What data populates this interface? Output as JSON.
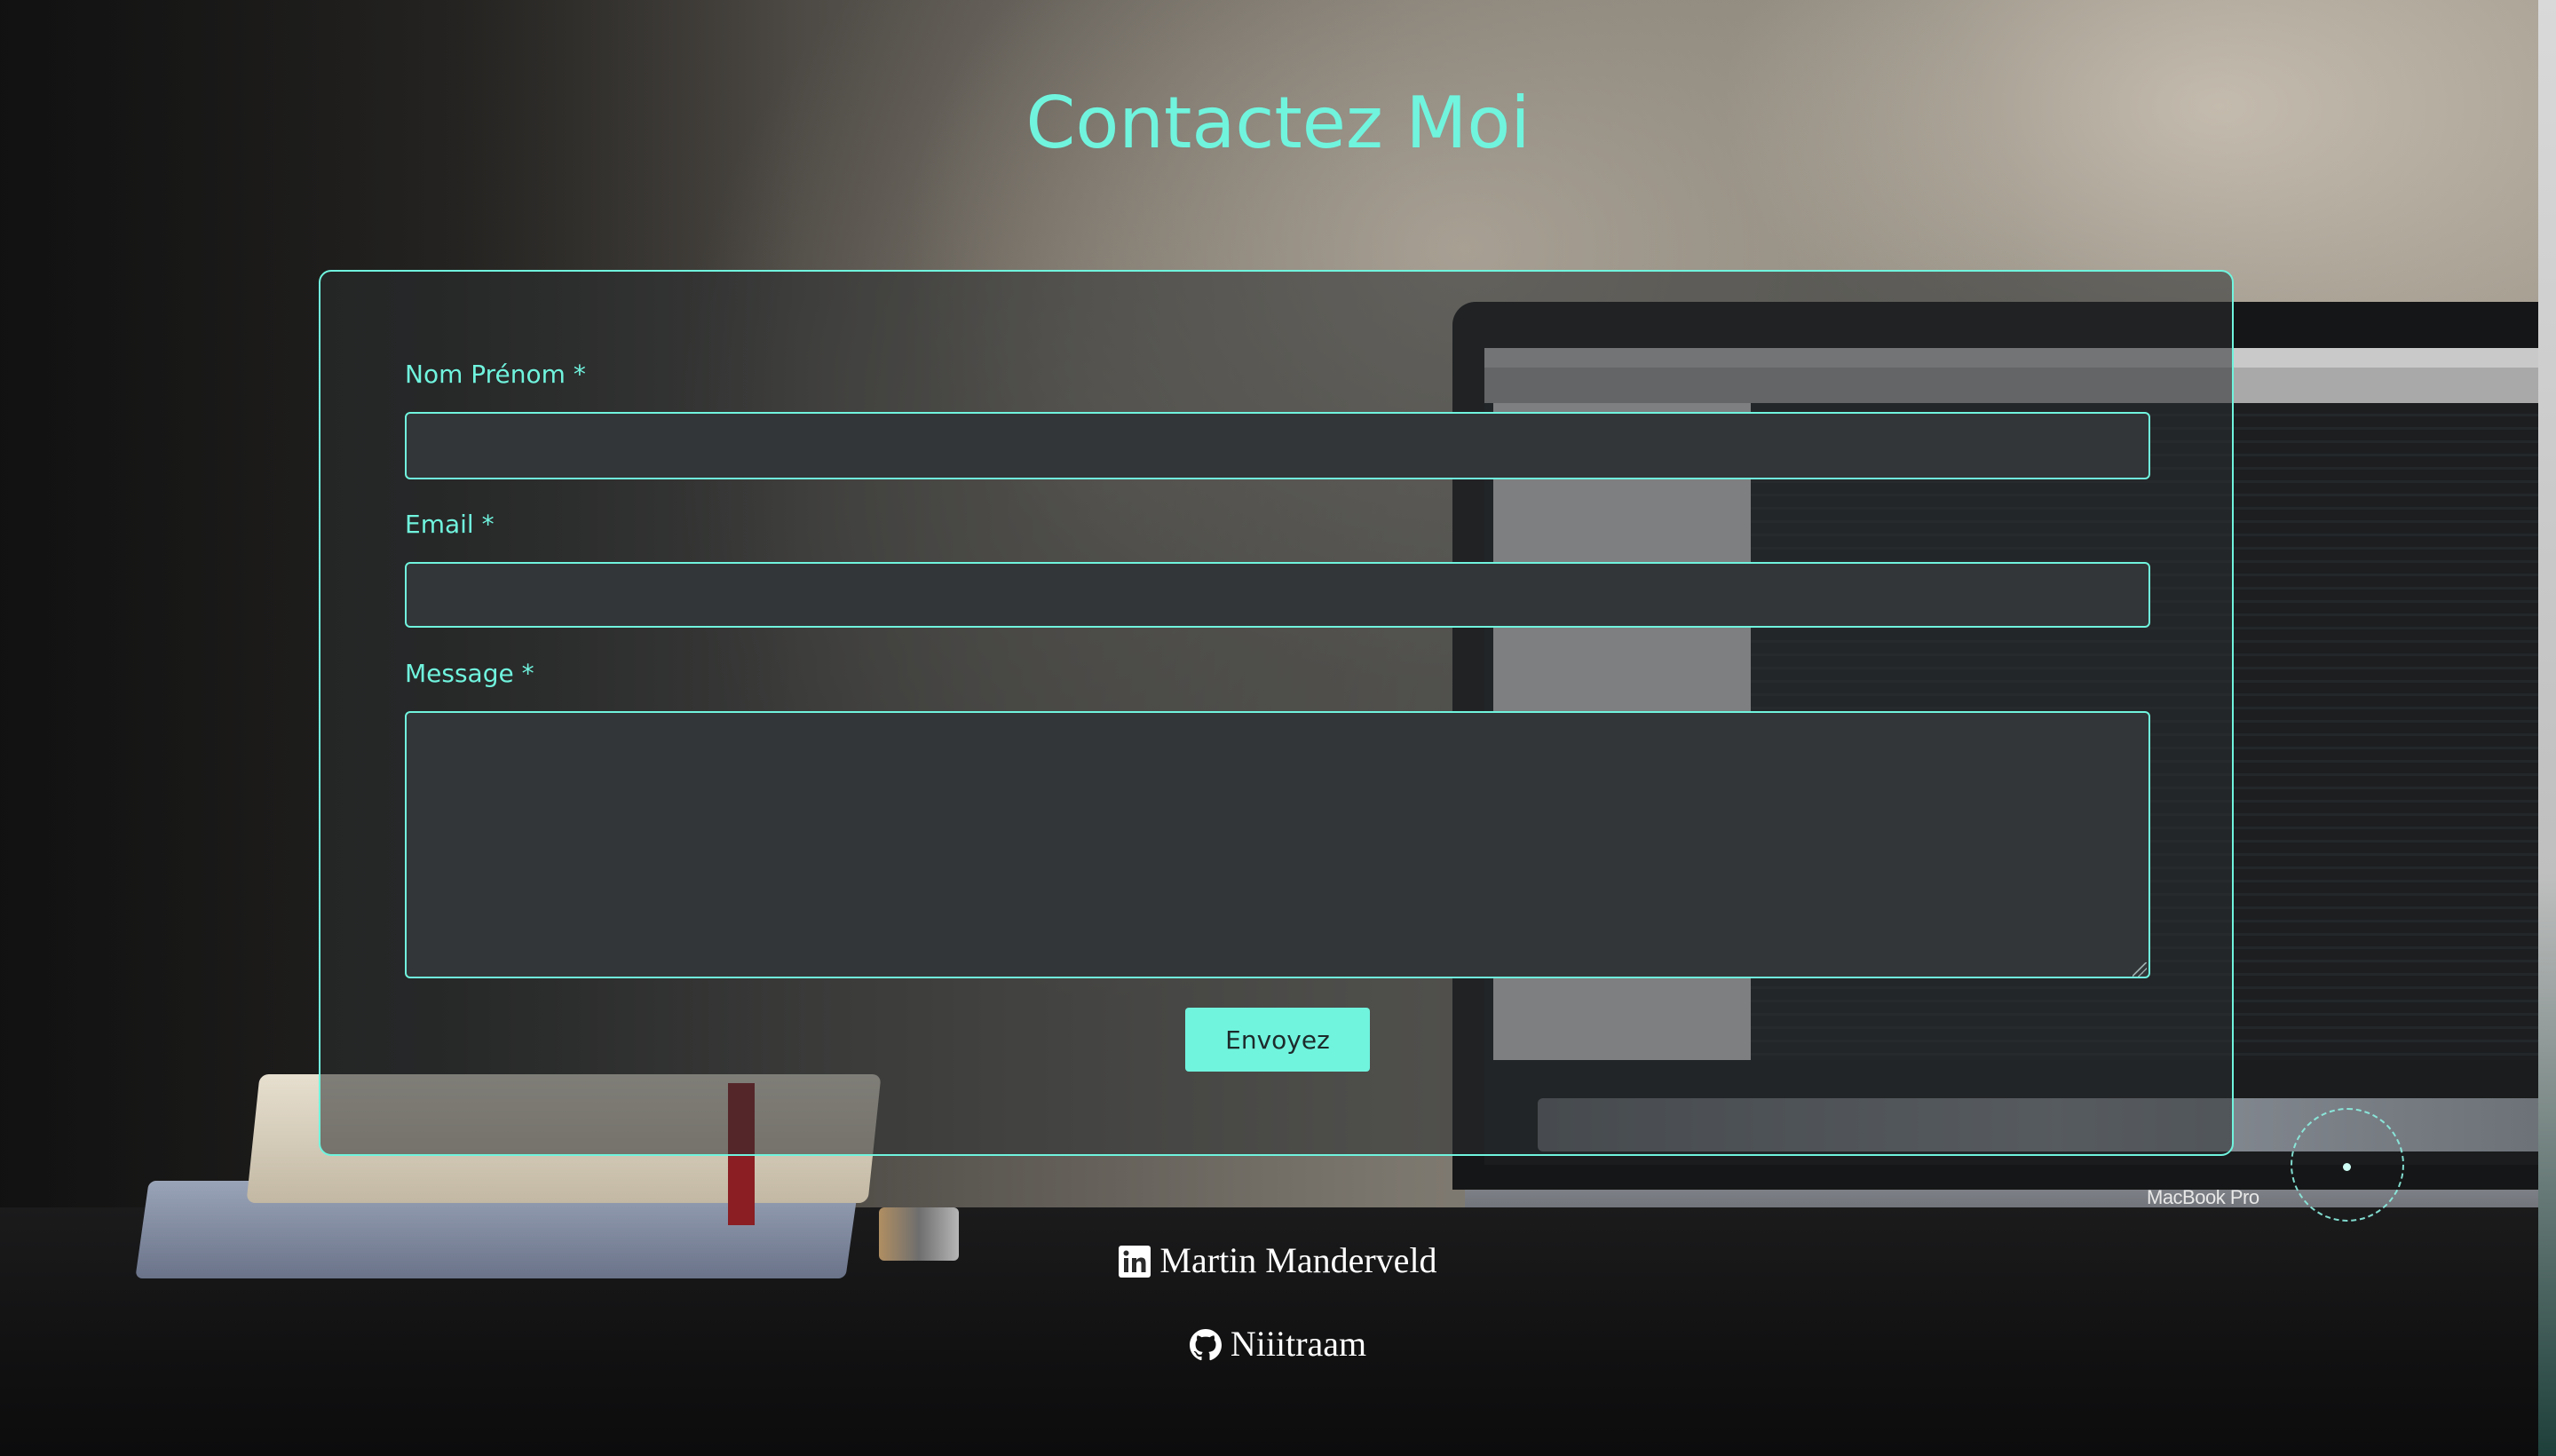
{
  "page": {
    "title": "Contactez Moi"
  },
  "form": {
    "fields": [
      {
        "label": "Nom Prénom *",
        "value": "",
        "placeholder": ""
      },
      {
        "label": "Email *",
        "value": "",
        "placeholder": ""
      },
      {
        "label": "Message *",
        "value": "",
        "placeholder": ""
      }
    ],
    "submit_label": "Envoyez"
  },
  "social": [
    {
      "label": "Martin Manderveld",
      "icon": "linkedin-icon"
    },
    {
      "label": "Niiitraam",
      "icon": "github-icon"
    }
  ],
  "background": {
    "device_brand_text": "MacBook Pro"
  },
  "colors": {
    "accent": "#70f4de",
    "input_background": "#333638",
    "text_light": "#ffffff"
  }
}
